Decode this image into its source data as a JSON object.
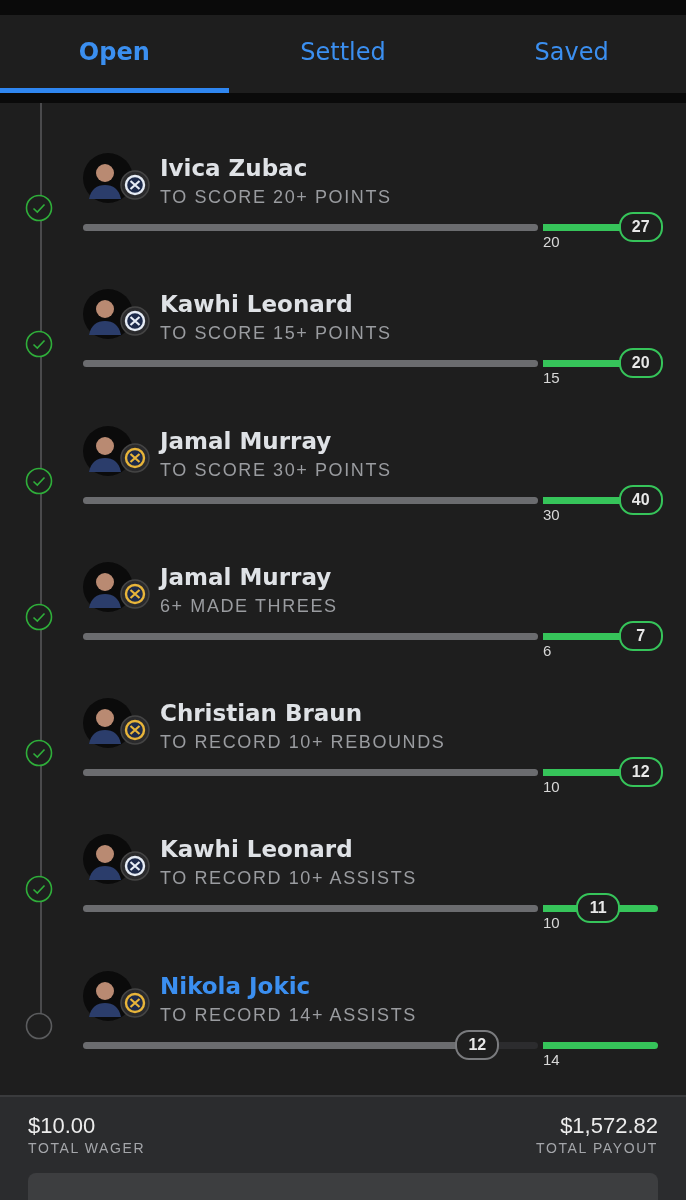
{
  "tabs": [
    {
      "label": "Open",
      "selected": true
    },
    {
      "label": "Settled",
      "selected": false
    },
    {
      "label": "Saved",
      "selected": false
    }
  ],
  "legs": [
    {
      "player": "Ivica Zubac",
      "market": "TO SCORE 20+ POINTS",
      "threshold": "20",
      "current": "27",
      "progress": {
        "level": 1
      },
      "beyond": {
        "level": 0.85
      },
      "hit": true,
      "live": false,
      "color": "#e6ecf5"
    },
    {
      "player": "Kawhi Leonard",
      "market": "TO SCORE 15+ POINTS",
      "threshold": "15",
      "current": "20",
      "progress": {
        "level": 1
      },
      "beyond": {
        "level": 0.85
      },
      "hit": true,
      "live": false,
      "color": "#e6ecf5"
    },
    {
      "player": "Jamal Murray",
      "market": "TO SCORE 30+ POINTS",
      "threshold": "30",
      "current": "40",
      "progress": {
        "level": 1
      },
      "beyond": {
        "level": 0.85
      },
      "hit": true,
      "live": false,
      "color": "#e8b53a"
    },
    {
      "player": "Jamal Murray",
      "market": "6+ MADE THREES",
      "threshold": "6",
      "current": "7",
      "progress": {
        "level": 1
      },
      "beyond": {
        "level": 0.85
      },
      "hit": true,
      "live": false,
      "color": "#e8b53a"
    },
    {
      "player": "Christian Braun",
      "market": "TO RECORD 10+ REBOUNDS",
      "threshold": "10",
      "current": "12",
      "progress": {
        "level": 1
      },
      "beyond": {
        "level": 0.85
      },
      "hit": true,
      "live": false,
      "color": "#e8b53a"
    },
    {
      "player": "Kawhi Leonard",
      "market": "TO RECORD 10+ ASSISTS",
      "threshold": "10",
      "current": "11",
      "progress": {
        "level": 1
      },
      "beyond": {
        "level": 0.48
      },
      "hit": true,
      "live": false,
      "color": "#e6ecf5"
    },
    {
      "player": "Nikola Jokic",
      "market": "TO RECORD 14+ ASSISTS",
      "threshold": "14",
      "current": "12",
      "progress": {
        "level": 0.866
      },
      "hit": false,
      "live": true,
      "color": "#e8b53a"
    }
  ],
  "totals": {
    "wager": "$10.00",
    "wager_label": "TOTAL WAGER",
    "payout": "$1,572.82",
    "payout_label": "TOTAL PAYOUT"
  }
}
